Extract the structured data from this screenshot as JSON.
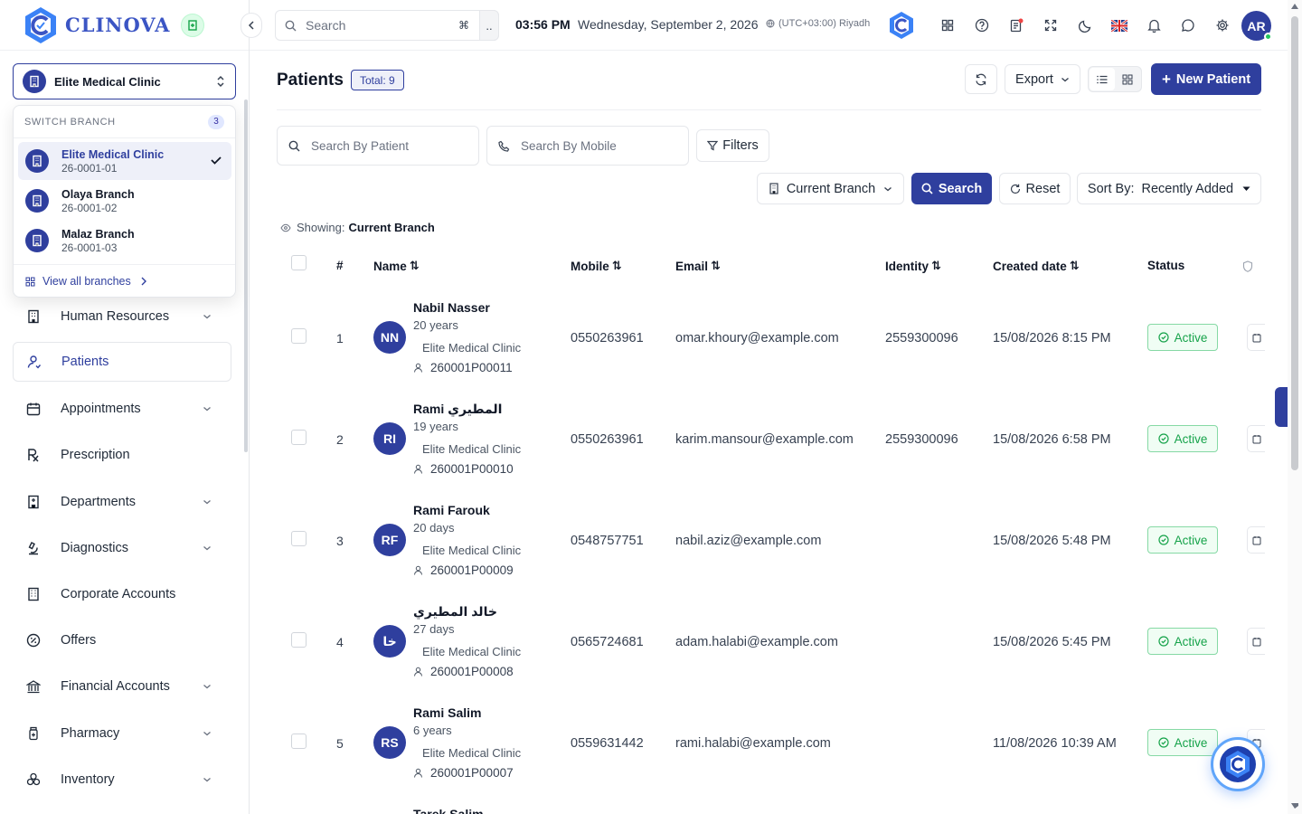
{
  "app": {
    "brand": "CLINOVA",
    "brand_color": "#2f3f9e"
  },
  "branch": {
    "selected": "Elite Medical Clinic",
    "popover_title": "SWITCH BRANCH",
    "count": "3",
    "items": [
      {
        "name": "Elite Medical Clinic",
        "code": "26-0001-01",
        "active": true
      },
      {
        "name": "Olaya Branch",
        "code": "26-0001-02",
        "active": false
      },
      {
        "name": "Malaz Branch",
        "code": "26-0001-03",
        "active": false
      }
    ],
    "view_all": "View all branches"
  },
  "sidebar": {
    "items": [
      {
        "label": "Human Resources",
        "icon": "building-icon",
        "has_children": true
      },
      {
        "label": "Patients",
        "icon": "user-heart-icon",
        "has_children": false,
        "active": true
      },
      {
        "label": "Appointments",
        "icon": "calendar-icon",
        "has_children": true
      },
      {
        "label": "Prescription",
        "icon": "rx-icon",
        "has_children": false
      },
      {
        "label": "Departments",
        "icon": "hospital-icon",
        "has_children": true
      },
      {
        "label": "Diagnostics",
        "icon": "microscope-icon",
        "has_children": true
      },
      {
        "label": "Corporate Accounts",
        "icon": "office-icon",
        "has_children": false
      },
      {
        "label": "Offers",
        "icon": "percent-icon",
        "has_children": false
      },
      {
        "label": "Financial Accounts",
        "icon": "bank-icon",
        "has_children": true
      },
      {
        "label": "Pharmacy",
        "icon": "pill-bottle-icon",
        "has_children": true
      },
      {
        "label": "Inventory",
        "icon": "boxes-icon",
        "has_children": true
      }
    ]
  },
  "topbar": {
    "search_placeholder": "Search",
    "search_shortcut": "⌘",
    "search_more": "..",
    "time": "03:56 PM",
    "date": "Wednesday, September 2, 2026",
    "timezone": "(UTC+03:00) Riyadh",
    "user_initials": "AR"
  },
  "page": {
    "title": "Patients",
    "total": "Total: 9",
    "export": "Export",
    "new_patient": "New Patient"
  },
  "filters": {
    "patient_placeholder": "Search By Patient",
    "mobile_placeholder": "Search By Mobile",
    "filters_label": "Filters",
    "branch_scope": "Current Branch",
    "search_label": "Search",
    "reset_label": "Reset",
    "sort_prefix": "Sort By:",
    "sort_value": "Recently Added",
    "showing_label": "Showing:",
    "showing_value": "Current Branch"
  },
  "table": {
    "headers": {
      "num": "#",
      "name": "Name",
      "mobile": "Mobile",
      "email": "Email",
      "identity": "Identity",
      "created": "Created date",
      "status": "Status"
    },
    "rows": [
      {
        "num": "1",
        "initials": "NN",
        "name": "Nabil Nasser",
        "age": "20 years",
        "clinic": "Elite Medical Clinic",
        "pid": "260001P00011",
        "mobile": "0550263961",
        "email": "omar.khoury@example.com",
        "identity": "2559300096",
        "created": "15/08/2026 8:15 PM",
        "status": "Active"
      },
      {
        "num": "2",
        "initials": "RI",
        "name": "Rami المطيري",
        "age": "19 years",
        "clinic": "Elite Medical Clinic",
        "pid": "260001P00010",
        "mobile": "0550263961",
        "email": "karim.mansour@example.com",
        "identity": "2559300096",
        "created": "15/08/2026 6:58 PM",
        "status": "Active"
      },
      {
        "num": "3",
        "initials": "RF",
        "name": "Rami Farouk",
        "age": "20 days",
        "clinic": "Elite Medical Clinic",
        "pid": "260001P00009",
        "mobile": "0548757751",
        "email": "nabil.aziz@example.com",
        "identity": "",
        "created": "15/08/2026 5:48 PM",
        "status": "Active"
      },
      {
        "num": "4",
        "initials": "خا",
        "name": "خالد المطيري",
        "age": "27 days",
        "clinic": "Elite Medical Clinic",
        "pid": "260001P00008",
        "mobile": "0565724681",
        "email": "adam.halabi@example.com",
        "identity": "",
        "created": "15/08/2026 5:45 PM",
        "status": "Active"
      },
      {
        "num": "5",
        "initials": "RS",
        "name": "Rami Salim",
        "age": "6 years",
        "clinic": "Elite Medical Clinic",
        "pid": "260001P00007",
        "mobile": "0559631442",
        "email": "rami.halabi@example.com",
        "identity": "",
        "created": "11/08/2026 10:39 AM",
        "status": "Active"
      }
    ],
    "partial_next_name": "Tarek Salim"
  }
}
